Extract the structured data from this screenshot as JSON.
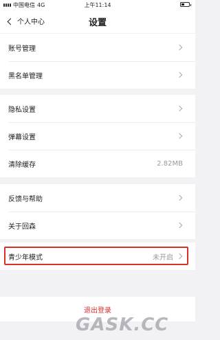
{
  "status_bar": {
    "carrier": "中国电信",
    "network": "4G",
    "time": "上午11:14"
  },
  "nav": {
    "back_label": "个人中心",
    "title": "设置"
  },
  "groups": [
    {
      "items": [
        {
          "label": "账号管理"
        },
        {
          "label": "黑名单管理"
        }
      ]
    },
    {
      "items": [
        {
          "label": "隐私设置"
        },
        {
          "label": "弹幕设置"
        },
        {
          "label": "清除缓存",
          "value": "2.82MB"
        }
      ]
    },
    {
      "items": [
        {
          "label": "反馈与帮助"
        },
        {
          "label": "关于回森"
        }
      ]
    },
    {
      "items": [
        {
          "label": "青少年模式",
          "value": "未开启"
        }
      ]
    }
  ],
  "logout": {
    "label": "退出登录"
  },
  "watermark": {
    "text": "GASK.CC"
  },
  "colors": {
    "accent_red": "#d9302a",
    "background": "#f2f2f4"
  }
}
